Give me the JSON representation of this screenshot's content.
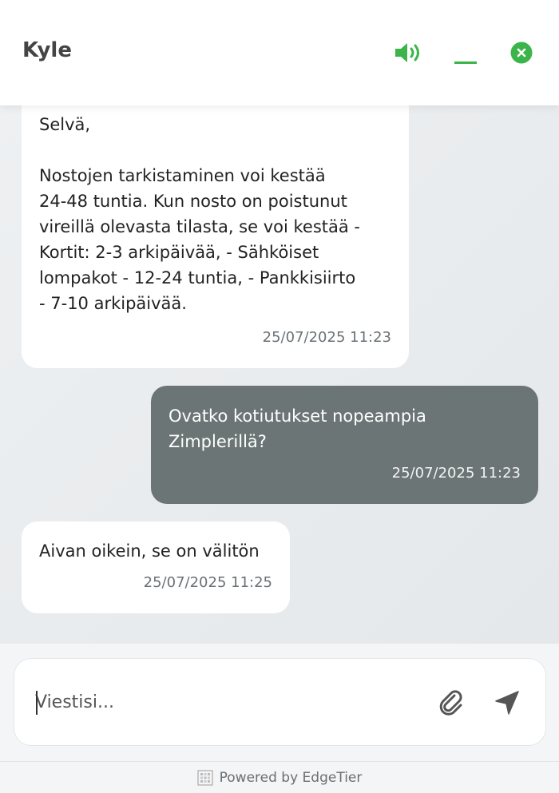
{
  "header": {
    "agent_name": "Kyle",
    "sound_icon": "speaker-volume-icon",
    "minimize_icon": "minimize-icon",
    "close_icon": "close-circle-icon",
    "accent_color": "#3bb54a"
  },
  "messages": [
    {
      "sender": "agent",
      "text": "Selvä,\n\nNostojen tarkistaminen voi kestää\n24-48 tuntia. Kun nosto on poistunut\nvireillä olevasta tilasta, se voi kestää -\nKortit: 2-3 arkipäivää, - Sähköiset\nlompakot - 12-24 tuntia, - Pankkisiirto\n- 7-10 arkipäivää.",
      "time": "25/07/2025 11:23"
    },
    {
      "sender": "user",
      "text": "Ovatko kotiutukset nopeampia\nZimplerillä?",
      "time": "25/07/2025 11:23"
    },
    {
      "sender": "agent",
      "text": "Aivan oikein, se on välitön",
      "time": "25/07/2025 11:25"
    }
  ],
  "composer": {
    "placeholder": "Viestisi...",
    "value": "",
    "attach_icon": "paperclip-icon",
    "send_icon": "send-arrow-icon"
  },
  "footer": {
    "text": "Powered by EdgeTier",
    "logo_icon": "edgetier-logo-icon"
  },
  "colors": {
    "user_bubble": "#6c7575",
    "agent_bubble": "#ffffff",
    "background": "#e9ecee"
  }
}
